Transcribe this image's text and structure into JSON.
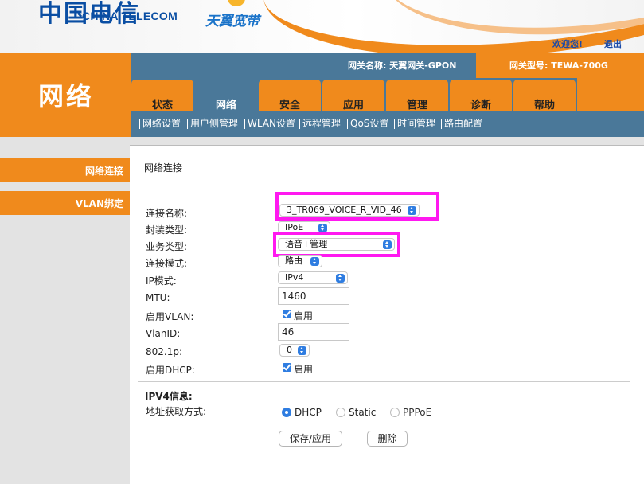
{
  "banner": {
    "logo_mark": "中国电信",
    "logo_text": "CHINA TELECOM",
    "brand": "天翼宽带",
    "welcome": "欢迎您!",
    "logout": "退出"
  },
  "header": {
    "section_title": "网络",
    "gateway_name": "网关名称:  天翼网关-GPON",
    "gateway_type": "网关型号: TEWA-700G"
  },
  "tabs": [
    {
      "label": "状态"
    },
    {
      "label": "网络"
    },
    {
      "label": "安全"
    },
    {
      "label": "应用"
    },
    {
      "label": "管理"
    },
    {
      "label": "诊断"
    },
    {
      "label": "帮助"
    }
  ],
  "active_tab": "网络",
  "subnav": [
    {
      "label": "网络设置"
    },
    {
      "label": "用户侧管理"
    },
    {
      "label": "WLAN设置"
    },
    {
      "label": "远程管理"
    },
    {
      "label": "QoS设置"
    },
    {
      "label": "时间管理"
    },
    {
      "label": "路由配置"
    }
  ],
  "sidebar": {
    "items": [
      {
        "label": "网络连接"
      },
      {
        "label": "VLAN绑定"
      }
    ]
  },
  "form": {
    "title": "网络连接",
    "connection_name_label": "连接名称:",
    "connection_name_value": "3_TR069_VOICE_R_VID_46",
    "encap_label": "封装类型:",
    "encap_value": "IPoE",
    "service_label": "业务类型:",
    "service_value": "语音+管理",
    "mode_label": "连接模式:",
    "mode_value": "路由",
    "ip_mode_label": "IP模式:",
    "ip_mode_value": "IPv4",
    "mtu_label": "MTU:",
    "mtu_value": "1460",
    "vlan_enable_label": "启用VLAN:",
    "vlan_enable_text": "启用",
    "vlan_id_label": "VlanID:",
    "vlan_id_value": "46",
    "dot1p_label": "802.1p:",
    "dot1p_value": "0",
    "dhcp_enable_label": "启用DHCP:",
    "dhcp_enable_text": "启用",
    "ipv4_info_label": "IPV4信息:",
    "addr_method_label": "地址获取方式:",
    "addr_options": [
      "DHCP",
      "Static",
      "PPPoE"
    ],
    "addr_selected": "DHCP",
    "save_label": "保存/应用",
    "delete_label": "删除"
  },
  "colors": {
    "orange": "#f08a1c",
    "steel_blue": "#4a7899",
    "highlight": "#ff18f0",
    "link_blue": "#1a4aa8"
  }
}
